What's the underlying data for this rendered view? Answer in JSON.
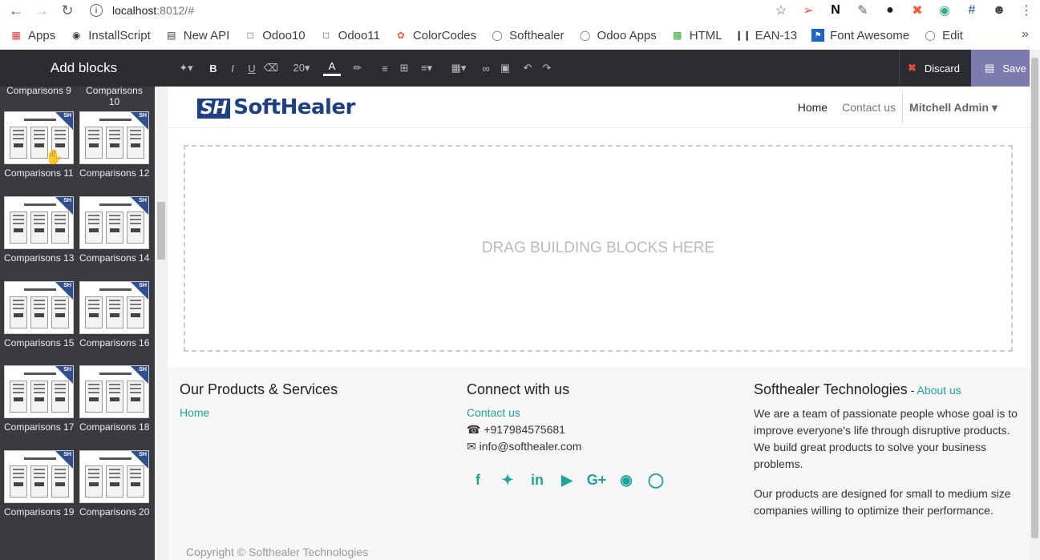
{
  "browser": {
    "url_host": "localhost",
    "url_rest": ":8012/#",
    "info_icon": "i"
  },
  "bookmarks": [
    {
      "label": "Apps",
      "icon": "apps-grid-icon"
    },
    {
      "label": "InstallScript",
      "icon": "github-icon"
    },
    {
      "label": "New API",
      "icon": "book-icon"
    },
    {
      "label": "Odoo10",
      "icon": "page-icon"
    },
    {
      "label": "Odoo11",
      "icon": "page-icon"
    },
    {
      "label": "ColorCodes",
      "icon": "color-wheel-icon"
    },
    {
      "label": "Softhealer",
      "icon": "odoo-circle-icon"
    },
    {
      "label": "Odoo Apps",
      "icon": "odoo-circle-icon"
    },
    {
      "label": "HTML",
      "icon": "html-icon"
    },
    {
      "label": "EAN-13",
      "icon": "barcode-icon"
    },
    {
      "label": "Font Awesome",
      "icon": "flag-icon"
    },
    {
      "label": "Edit",
      "icon": "odoo-circle-icon"
    }
  ],
  "sidebar": {
    "title": "Add blocks",
    "top_labels": [
      "Comparisons 9",
      "Comparisons 10"
    ],
    "blocks": [
      "Comparisons 11",
      "Comparisons 12",
      "Comparisons 13",
      "Comparisons 14",
      "Comparisons 15",
      "Comparisons 16",
      "Comparisons 17",
      "Comparisons 18",
      "Comparisons 19",
      "Comparisons 20"
    ],
    "badge": "SH"
  },
  "editor": {
    "font_size": "20",
    "discard_label": "Discard",
    "save_label": "Save"
  },
  "site": {
    "logo_mark": "SH",
    "logo_text": "SoftHealer",
    "nav": {
      "home": "Home",
      "contact": "Contact us",
      "user": "Mitchell Admin"
    },
    "dropzone_text": "DRAG BUILDING BLOCKS HERE",
    "footer": {
      "col1_title": "Our Products & Services",
      "col1_link": "Home",
      "col2_title": "Connect with us",
      "col2_link": "Contact us",
      "phone": "+917984575681",
      "email": "info@softhealer.com",
      "col3_title": "Softhealer Technologies",
      "col3_sep": " - ",
      "col3_link": "About us",
      "col3_p1": "We are a team of passionate people whose goal is to improve everyone's life through disruptive products. We build great products to solve your business problems.",
      "col3_p2": "Our products are designed for small to medium size companies willing to optimize their performance.",
      "copyright": "Copyright © Softhealer Technologies"
    },
    "accent": "#1fa39a"
  }
}
